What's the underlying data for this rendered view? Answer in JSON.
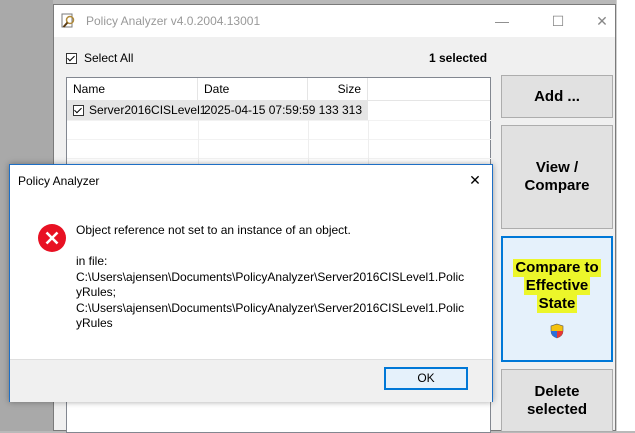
{
  "main_window": {
    "title": "Policy Analyzer v4.0.2004.13001",
    "controls": {
      "minimize": "—",
      "maximize": "☐",
      "close": "✕"
    },
    "select_all_label": "Select All",
    "selected_count": "1 selected",
    "columns": [
      "Name",
      "Date",
      "Size"
    ],
    "rows": [
      {
        "name": "Server2016CISLevel1",
        "date": "2025-04-15 07:59:59",
        "size": "133 313",
        "checked": true
      }
    ],
    "buttons": {
      "add": "Add ...",
      "view_compare_line1": "View /",
      "view_compare_line2": "Compare",
      "compare_effective_line1": "Compare to",
      "compare_effective_line2": "Effective",
      "compare_effective_line3": "State",
      "delete_line1": "Delete",
      "delete_line2": "selected"
    }
  },
  "dialog": {
    "title": "Policy Analyzer",
    "close": "✕",
    "message": "Object reference not set to an instance of an object.",
    "detail_line1": "in file:",
    "detail_line2": "C:\\Users\\ajensen\\Documents\\PolicyAnalyzer\\Server2016CISLevel1.Polic",
    "detail_line3": "yRules;",
    "detail_line4": "C:\\Users\\ajensen\\Documents\\PolicyAnalyzer\\Server2016CISLevel1.Polic",
    "detail_line5": "yRules",
    "ok_label": "OK"
  },
  "icons": {
    "app": "magnifier-icon",
    "error": "error-icon",
    "uac": "shield-icon"
  },
  "colors": {
    "accent": "#0078d7",
    "highlight": "#ecf62a",
    "error_red": "#e81123"
  }
}
